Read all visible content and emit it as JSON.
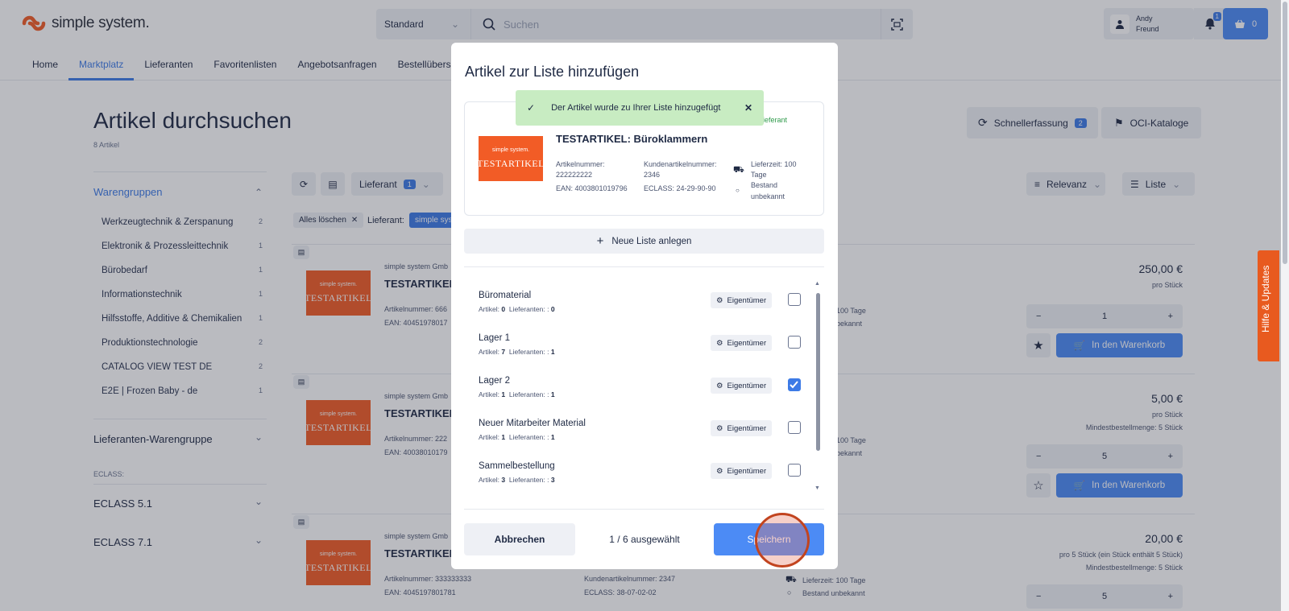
{
  "header": {
    "logo_text": "simple system.",
    "search_select": "Standard",
    "search_placeholder": "Suchen",
    "user_first": "Andy",
    "user_last": "Freund",
    "notif_count": "1",
    "cart_count": "0"
  },
  "nav": [
    "Home",
    "Marktplatz",
    "Lieferanten",
    "Favoritenlisten",
    "Angebotsanfragen",
    "Bestellübersicht"
  ],
  "page": {
    "title": "Artikel durchsuchen",
    "count": "8 Artikel",
    "quick_entry": "Schnellerfassung",
    "quick_entry_count": "2",
    "oci": "OCI-Kataloge",
    "supplier_filter": "Lieferant",
    "supplier_filter_count": "1",
    "sort": "Relevanz",
    "view": "Liste",
    "clear_all": "Alles löschen",
    "filter_label": "Lieferant:",
    "filter_value": "simple syst"
  },
  "sidebar": {
    "groups_title": "Warengruppen",
    "categories": [
      {
        "label": "Werkzeugtechnik & Zerspanung",
        "count": "2"
      },
      {
        "label": "Elektronik & Prozessleittechnik",
        "count": "1"
      },
      {
        "label": "Bürobedarf",
        "count": "1"
      },
      {
        "label": "Informationstechnik",
        "count": "1"
      },
      {
        "label": "Hilfsstoffe, Additive & Chemikalien",
        "count": "1"
      },
      {
        "label": "Produktionstechnologie",
        "count": "2"
      },
      {
        "label": "CATALOG VIEW TEST DE",
        "count": "2"
      },
      {
        "label": "E2E | Frozen Baby - de",
        "count": "1"
      }
    ],
    "supplier_groups": "Lieferanten-Warengruppe",
    "eclass_label": "ECLASS:",
    "eclass51": "ECLASS 5.1",
    "eclass71": "ECLASS 7.1"
  },
  "products": [
    {
      "supplier": "simple system Gmb",
      "name": "TESTARTIKEL: /",
      "art": "Artikelnummer: 666",
      "ean": "EAN: 40451978017",
      "delivery": "100 Tage",
      "stock": "bekannt",
      "price": "250,00 €",
      "unit": "pro Stück",
      "minorder": "",
      "qty": "1",
      "fav": true
    },
    {
      "supplier": "simple system Gmb",
      "name": "TESTARTIKEL:",
      "art": "Artikelnummer: 222",
      "ean": "EAN: 40038010179",
      "delivery": "100 Tage",
      "stock": "bekannt",
      "price": "5,00 €",
      "unit": "pro Stück",
      "minorder": "Mindestbestellmenge: 5 Stück",
      "qty": "5",
      "fav": false
    },
    {
      "supplier": "simple system Gmb",
      "name": "TESTARTIKEL:",
      "art": "Artikelnummer: 333333333",
      "ean": "EAN: 4045197801781",
      "cust": "Kundenartikelnummer: 2347",
      "eclass": "ECLASS: 38-07-02-02",
      "delivery": "Lieferzeit: 100 Tage",
      "stock": "Bestand unbekannt",
      "price": "20,00 €",
      "unit": "pro 5 Stück (ein Stück enthält 5 Stück)",
      "minorder": "Mindestbestellmenge: 5 Stück",
      "qty": "5"
    }
  ],
  "cart_label": "In den Warenkorb",
  "img_brand": "simple system.",
  "img_label": "TESTARTIKEL",
  "modal": {
    "title": "Artikel zur Liste hinzufügen",
    "toast": "Der Artikel wurde zu Ihrer Liste hinzugefügt",
    "supplier_tag": "ieferant",
    "product_name": "TESTARTIKEL: Büroklammern",
    "art_label": "Artikelnummer:",
    "art_value": "222222222",
    "ean": "EAN: 4003801019796",
    "cust_label": "Kundenartikelnummer:",
    "cust_value": "2346",
    "eclass": "ECLASS: 24-29-90-90",
    "delivery_1": "Lieferzeit: 100",
    "delivery_2": "Tage",
    "stock_1": "Bestand",
    "stock_2": "unbekannt",
    "new_list": "Neue Liste anlegen",
    "lists": [
      {
        "name": "Büromaterial",
        "articles": "0",
        "suppliers": "0",
        "checked": false
      },
      {
        "name": "Lager 1",
        "articles": "7",
        "suppliers": "1",
        "checked": false
      },
      {
        "name": "Lager 2",
        "articles": "1",
        "suppliers": "1",
        "checked": true
      },
      {
        "name": "Neuer Mitarbeiter Material",
        "articles": "1",
        "suppliers": "1",
        "checked": false
      },
      {
        "name": "Sammelbestellung",
        "articles": "3",
        "suppliers": "3",
        "checked": false
      }
    ],
    "articles_label": "Artikel:",
    "suppliers_label": "Lieferanten: :",
    "owner": "Eigentümer",
    "cancel": "Abbrechen",
    "selected": "1 / 6 ausgewählt",
    "save": "Speichern"
  },
  "help_tab": "Hilfe & Updates",
  "colors": {
    "accent": "#4c8bf5",
    "brand": "#f25c26",
    "toast": "#c8ecc2"
  }
}
